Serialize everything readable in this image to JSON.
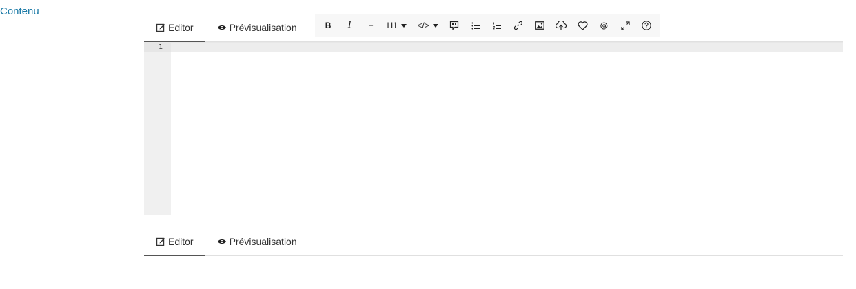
{
  "field": {
    "label": "Contenu"
  },
  "tabs": [
    {
      "label": "Editor",
      "icon": "edit-icon",
      "active": true
    },
    {
      "label": "Prévisualisation",
      "icon": "eye-icon",
      "active": false
    }
  ],
  "toolbar": {
    "bold": "B",
    "italic": "I",
    "strike": "−",
    "heading": "H1",
    "code": "</>",
    "items": [
      "bold",
      "italic",
      "horizontal-rule",
      "heading",
      "code-block",
      "quote",
      "unordered-list",
      "ordered-list",
      "link",
      "image",
      "upload",
      "heart",
      "mention",
      "fullscreen",
      "help"
    ]
  },
  "editor": {
    "line_numbers": [
      "1"
    ]
  },
  "bottom_tabs": [
    {
      "label": "Editor",
      "active": true
    },
    {
      "label": "Prévisualisation",
      "active": false
    }
  ]
}
